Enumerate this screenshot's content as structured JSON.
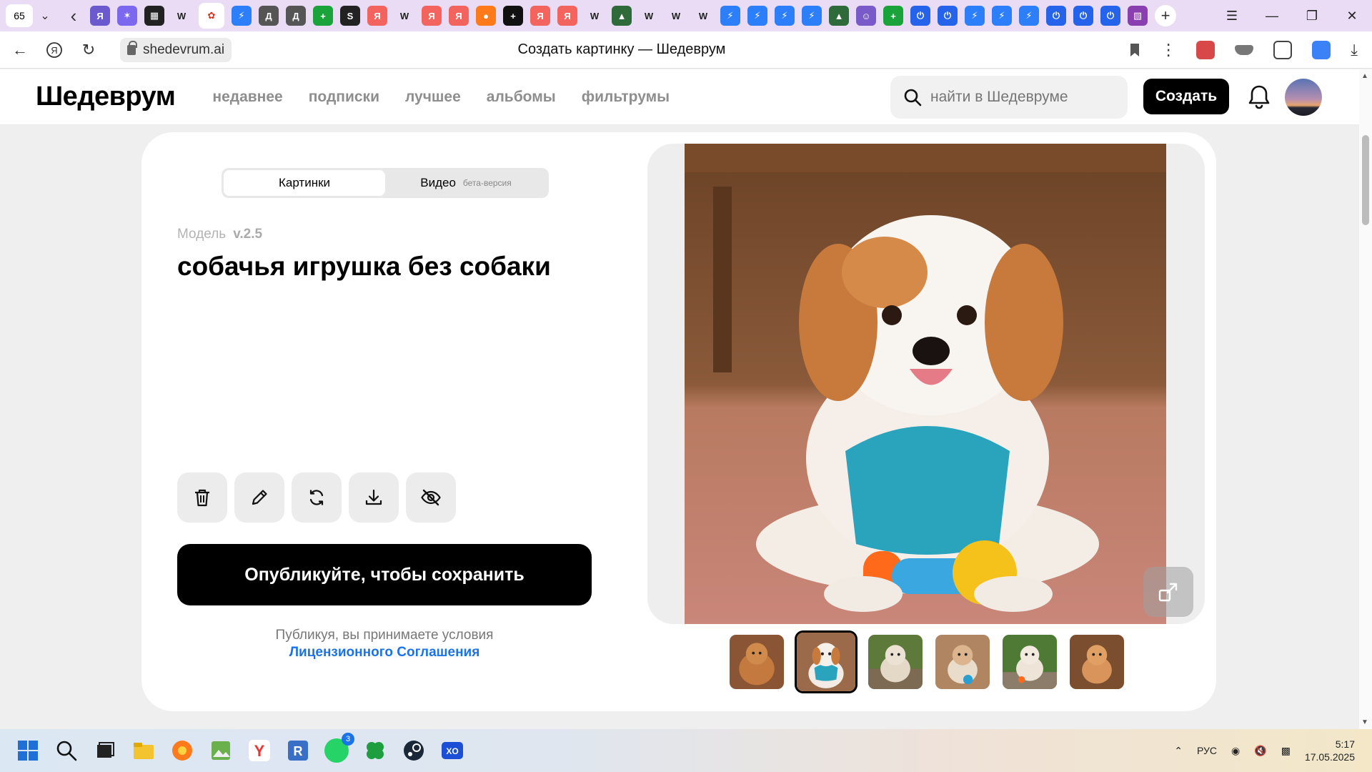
{
  "browser": {
    "tab_count": "65",
    "url": "shedevrum.ai",
    "page_title": "Создать картинку — Шедеврум",
    "favicons": [
      {
        "name": "yandex-icon",
        "color": "#6a5acd",
        "glyph": "Я"
      },
      {
        "name": "ai-icon",
        "color": "#7b68ee",
        "glyph": "✶"
      },
      {
        "name": "pattern-icon",
        "color": "#222222",
        "glyph": "▦"
      },
      {
        "name": "wikipedia-icon",
        "color": "#ffffff",
        "glyph": "W"
      },
      {
        "name": "shedevrum-icon",
        "color": "#e0301e",
        "glyph": "✿"
      },
      {
        "name": "bolt-icon",
        "color": "#2d7ff9",
        "glyph": "⚡"
      },
      {
        "name": "letter-d-icon",
        "color": "#555555",
        "glyph": "Д"
      },
      {
        "name": "letter-d-icon",
        "color": "#555555",
        "glyph": "Д"
      },
      {
        "name": "plus-green-icon",
        "color": "#1aa33a",
        "glyph": "+"
      },
      {
        "name": "s-dark-icon",
        "color": "#222222",
        "glyph": "S"
      },
      {
        "name": "yandex-icon",
        "color": "#f4645f",
        "glyph": "Я"
      },
      {
        "name": "wikipedia-icon",
        "color": "#ffffff",
        "glyph": "W"
      },
      {
        "name": "yandex-icon",
        "color": "#f4645f",
        "glyph": "Я"
      },
      {
        "name": "yandex-icon",
        "color": "#f4645f",
        "glyph": "Я"
      },
      {
        "name": "fire-icon",
        "color": "#ff7a1a",
        "glyph": "●"
      },
      {
        "name": "plus-dark-icon",
        "color": "#111111",
        "glyph": "+"
      },
      {
        "name": "yandex-icon",
        "color": "#f4645f",
        "glyph": "Я"
      },
      {
        "name": "yandex-icon",
        "color": "#f4645f",
        "glyph": "Я"
      },
      {
        "name": "wikipedia-icon",
        "color": "#ffffff",
        "glyph": "W"
      },
      {
        "name": "car-icon",
        "color": "#2f6b3a",
        "glyph": "▲"
      },
      {
        "name": "wikipedia-icon",
        "color": "#ffffff",
        "glyph": "W"
      },
      {
        "name": "wikipedia-icon",
        "color": "#ffffff",
        "glyph": "W"
      },
      {
        "name": "wikipedia-icon",
        "color": "#ffffff",
        "glyph": "W"
      },
      {
        "name": "bolt-icon",
        "color": "#2d7ff9",
        "glyph": "⚡"
      },
      {
        "name": "bolt-icon",
        "color": "#2d7ff9",
        "glyph": "⚡"
      },
      {
        "name": "bolt-icon",
        "color": "#2d7ff9",
        "glyph": "⚡"
      },
      {
        "name": "bolt-icon",
        "color": "#2d7ff9",
        "glyph": "⚡"
      },
      {
        "name": "car-icon",
        "color": "#2f6b3a",
        "glyph": "▲"
      },
      {
        "name": "person-icon",
        "color": "#7a5ac8",
        "glyph": "☺"
      },
      {
        "name": "plus-green-icon",
        "color": "#1aa33a",
        "glyph": "+"
      },
      {
        "name": "power-icon",
        "color": "#2563eb",
        "glyph": "⏻"
      },
      {
        "name": "power-icon",
        "color": "#2563eb",
        "glyph": "⏻"
      },
      {
        "name": "bolt-icon",
        "color": "#2d7ff9",
        "glyph": "⚡"
      },
      {
        "name": "bolt-icon",
        "color": "#2d7ff9",
        "glyph": "⚡"
      },
      {
        "name": "bolt-icon",
        "color": "#2d7ff9",
        "glyph": "⚡"
      },
      {
        "name": "power-icon",
        "color": "#2563eb",
        "glyph": "⏻"
      },
      {
        "name": "power-icon",
        "color": "#2563eb",
        "glyph": "⏻"
      },
      {
        "name": "power-icon",
        "color": "#2563eb",
        "glyph": "⏻"
      },
      {
        "name": "art-icon",
        "color": "#8a3fb0",
        "glyph": "▧"
      }
    ]
  },
  "site": {
    "logo": "Шедеврум",
    "nav": [
      "недавнее",
      "подписки",
      "лучшее",
      "альбомы",
      "фильтрумы"
    ],
    "search_placeholder": "найти в Шедевруме",
    "create_label": "Создать"
  },
  "editor": {
    "tabs": {
      "images": "Картинки",
      "video": "Видео",
      "video_badge": "бета-версия"
    },
    "model_label": "Модель",
    "model_version": "v.2.5",
    "prompt": "собачья игрушка без собаки",
    "tools": [
      "trash-icon",
      "pencil-icon",
      "regenerate-icon",
      "download-icon",
      "hide-icon"
    ],
    "publish_label": "Опубликуйте, чтобы сохранить",
    "terms_text": "Публикуя, вы принимаете условия",
    "terms_link": "Лицензионного Соглашения",
    "selected_thumb": 2,
    "thumb_count": 6
  },
  "taskbar": {
    "whatsapp_badge": "3",
    "lang": "РУС",
    "time": "5:17",
    "date": "17.05.2025"
  },
  "colors": {
    "accent_link": "#1a73e8",
    "primary_button": "#000000",
    "tabstrip_bg": "#e9dcf4"
  }
}
